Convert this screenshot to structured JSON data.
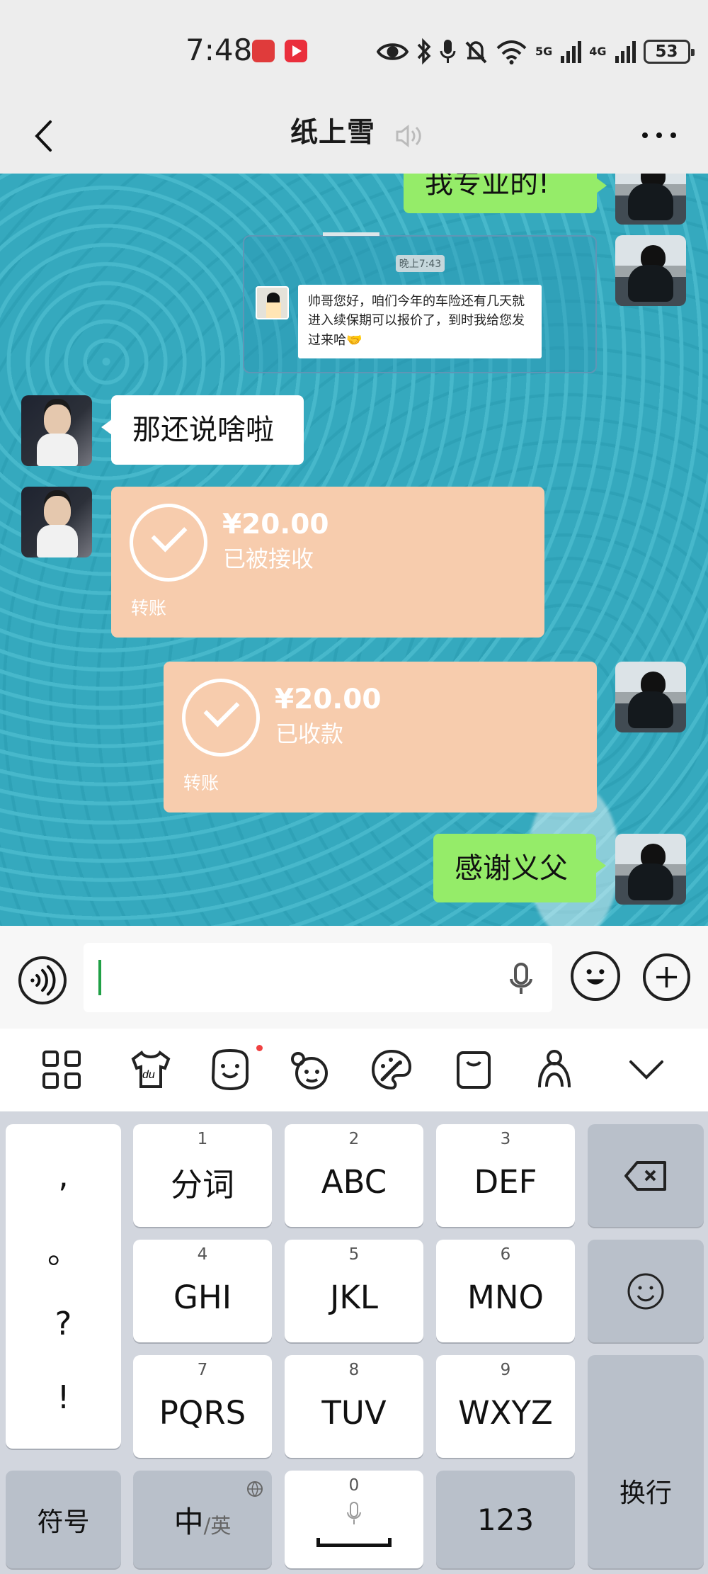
{
  "status_bar": {
    "time": "7:48",
    "network_5g": "5G",
    "network_4g": "4G",
    "battery": "53"
  },
  "header": {
    "title": "纸上雪"
  },
  "messages": {
    "top_partial": "我专业的!",
    "screenshot_time": "晚上7:43",
    "screenshot_text": "帅哥您好，咱们今年的车险还有几天就进入续保期可以报价了，到时我给您发过来哈🤝",
    "incoming_text": "那还说啥啦",
    "transfer_received": {
      "amount": "¥20.00",
      "status": "已被接收",
      "label": "转账"
    },
    "transfer_accepted": {
      "amount": "¥20.00",
      "status": "已收款",
      "label": "转账"
    },
    "thanks": "感谢义父"
  },
  "keyboard": {
    "punctuation": [
      ",",
      "。",
      "?",
      "!"
    ],
    "keys": [
      {
        "number": "1",
        "label": "分词"
      },
      {
        "number": "2",
        "label": "ABC"
      },
      {
        "number": "3",
        "label": "DEF"
      },
      {
        "number": "4",
        "label": "GHI"
      },
      {
        "number": "5",
        "label": "JKL"
      },
      {
        "number": "6",
        "label": "MNO"
      },
      {
        "number": "7",
        "label": "PQRS"
      },
      {
        "number": "8",
        "label": "TUV"
      },
      {
        "number": "9",
        "label": "WXYZ"
      }
    ],
    "enter": "换行",
    "symbols": "符号",
    "language_main": "中",
    "language_secondary": "/英",
    "space_number": "0",
    "numbers": "123"
  },
  "icons": {
    "back": "chevron-left-icon",
    "muted": "muted-speaker-icon",
    "more": "more-options-icon",
    "voice": "voice-input-icon",
    "emoji": "emoji-icon",
    "plus": "plus-icon"
  }
}
